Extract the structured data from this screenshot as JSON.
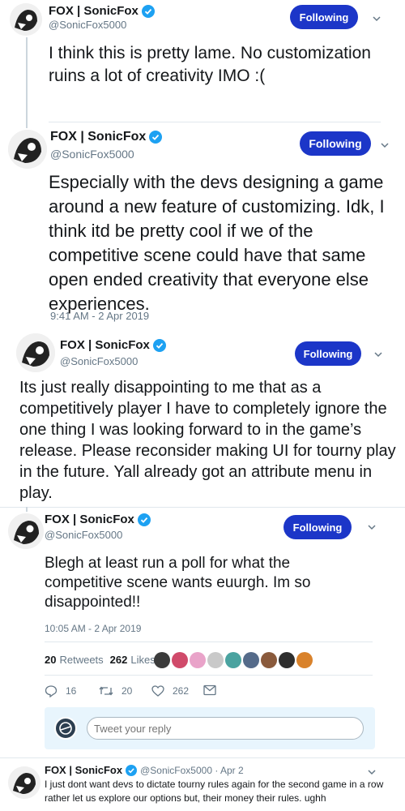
{
  "author": {
    "name": "FOX | SonicFox",
    "handle": "@SonicFox5000",
    "follow_label": "Following"
  },
  "tweets": [
    {
      "text": "I think this is pretty lame. No customization ruins a lot of creativity IMO :("
    },
    {
      "text": "Especially with the devs designing a game around a new feature of customizing. Idk, I think itd be pretty cool if we of the competitive scene could have that same open ended creativity that everyone else experiences.",
      "timestamp": "9:41 AM - 2 Apr 2019"
    },
    {
      "text": "Its just really disappointing to me that as a competitively player I have to completely ignore the one thing I was looking forward to in the game’s release. Please reconsider making UI for tourny play in the future. Yall already got an attribute menu in play."
    },
    {
      "text": "Blegh at least run a poll for what the competitive scene wants euurgh. Im so disappointed!!",
      "timestamp": "10:05 AM - 2 Apr 2019",
      "retweets_count": "20",
      "retweets_label": "Retweets",
      "likes_count": "262",
      "likes_label": "Likes",
      "actions": {
        "replies": "16",
        "retweets": "20",
        "likes": "262"
      },
      "reply_placeholder": "Tweet your reply"
    }
  ],
  "reply": {
    "name": "FOX | SonicFox",
    "handle_date": "@SonicFox5000 · Apr 2",
    "text": "I just dont want devs to dictate tourny rules again for the second game in a row rather let us explore our options but, their money their rules. ughh"
  },
  "colors": {
    "accent": "#1c36c8",
    "verified": "#1da1f2",
    "heart": "#e0245e"
  }
}
